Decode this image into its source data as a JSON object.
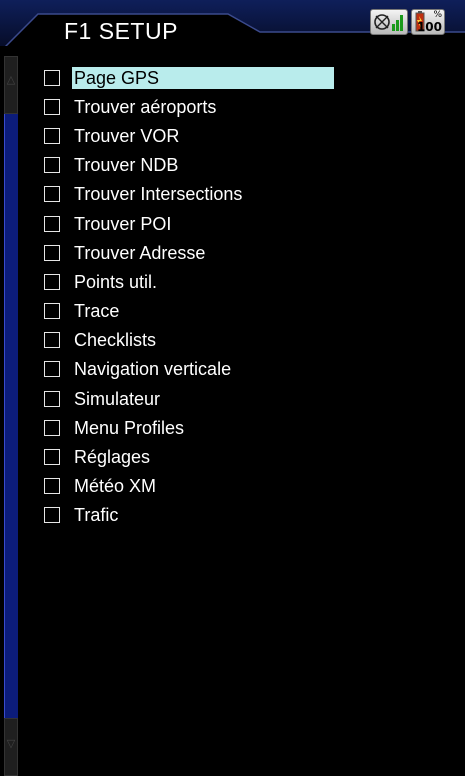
{
  "header": {
    "title": "F1 SETUP"
  },
  "status": {
    "icons": [
      "gps-satellite-icon",
      "signal-strength-icon",
      "battery-icon"
    ],
    "battery_label": "%",
    "battery_value": "100"
  },
  "menu": {
    "items": [
      {
        "label": "Page GPS",
        "selected": true
      },
      {
        "label": "Trouver aéroports"
      },
      {
        "label": "Trouver VOR"
      },
      {
        "label": "Trouver NDB"
      },
      {
        "label": "Trouver Intersections"
      },
      {
        "label": "Trouver POI"
      },
      {
        "label": "Trouver Adresse"
      },
      {
        "label": "Points util."
      },
      {
        "label": "Trace"
      },
      {
        "label": "Checklists"
      },
      {
        "label": "Navigation verticale"
      },
      {
        "label": "Simulateur"
      },
      {
        "label": "Menu Profiles"
      },
      {
        "label": "Réglages"
      },
      {
        "label": "Météo XM"
      },
      {
        "label": "Trafic"
      }
    ]
  },
  "colors": {
    "selection": "#b9ecec",
    "header": "#0d1a4a",
    "scrollbar": "#0c1c7a"
  }
}
